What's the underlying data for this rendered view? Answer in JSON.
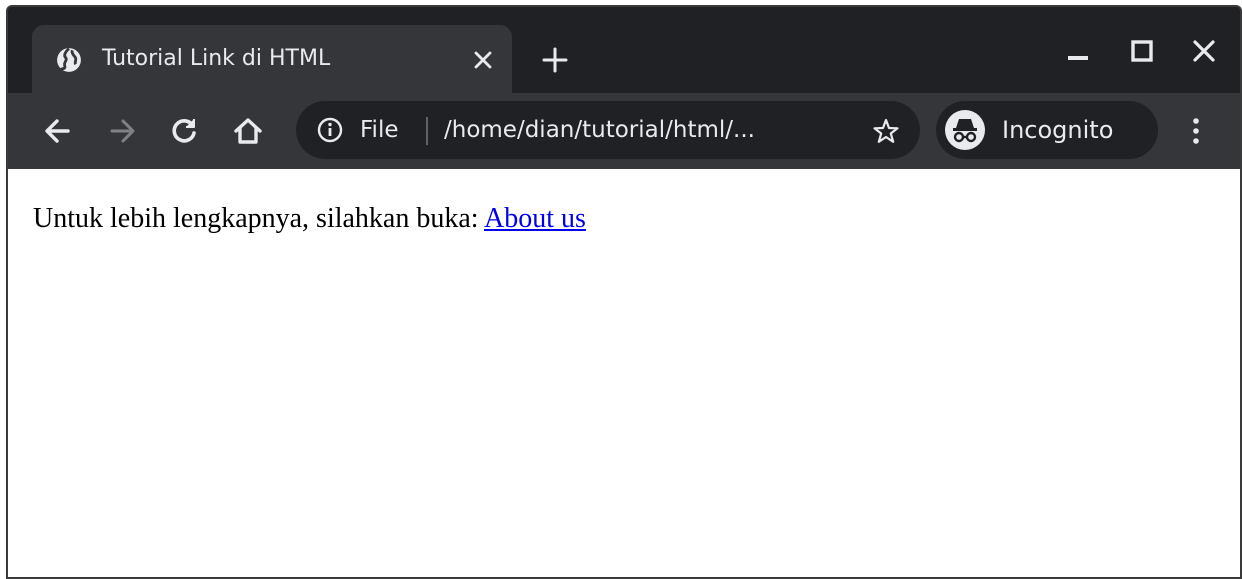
{
  "window": {
    "tab": {
      "title": "Tutorial Link di HTML",
      "favicon": "globe-icon"
    },
    "controls": [
      "minimize-icon",
      "maximize-icon",
      "close-icon"
    ]
  },
  "toolbar": {
    "back": "back-arrow-icon",
    "forward": "forward-arrow-icon",
    "reload": "reload-icon",
    "home": "home-icon",
    "omnibox": {
      "scheme_label": "File",
      "url": "/home/dian/tutorial/html/..."
    },
    "incognito_label": "Incognito"
  },
  "page": {
    "text": "Untuk lebih lengkapnya, silahkan buka: ",
    "link_text": "About us"
  },
  "colors": {
    "frame": "#202124",
    "toolbar": "#35363a",
    "text_light": "#e8eaed",
    "link": "#0000ee"
  }
}
